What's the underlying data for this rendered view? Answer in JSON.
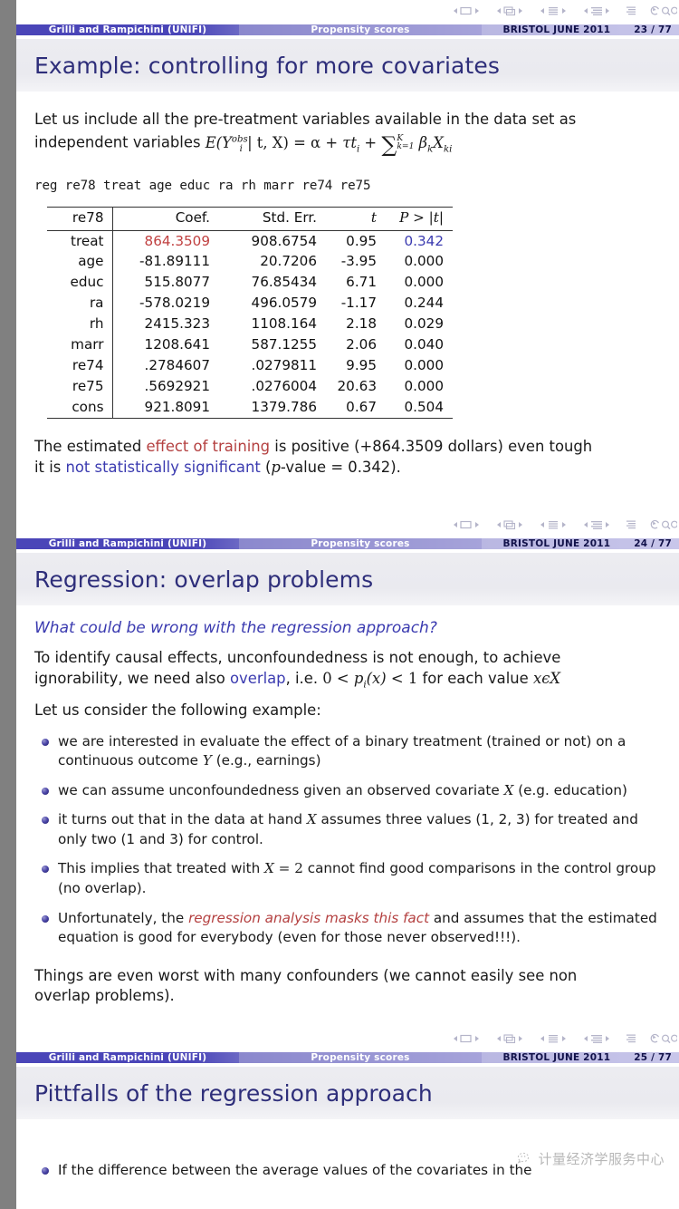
{
  "footer": {
    "author": "Grilli and Rampichini  (UNIFI)",
    "short_title": "Propensity scores",
    "venue": "BRISTOL JUNE 2011"
  },
  "slides": [
    {
      "page_number": "23 / 77",
      "title": "Example: controlling for more covariates",
      "intro_line1": "Let us include all the pre-treatment variables available in the data set as",
      "intro_line2_lead": "independent variables",
      "formula": {
        "lhs_E": "E",
        "lhs_Y": "Y",
        "lhs_Y_sup": "obs",
        "lhs_Y_sub": "i",
        "cond": "| t, X) =",
        "alpha": "α",
        "plus1": "+",
        "tau": "τ",
        "t_i": "t",
        "t_i_sub": "i",
        "plus2": "+",
        "sum": "∑",
        "sum_upper": "K",
        "sum_lower": "k=1",
        "beta": "β",
        "beta_sub": "k",
        "X": "X",
        "X_sub": "ki"
      },
      "command": "reg re78 treat age educ ra rh marr re74 re75",
      "table": {
        "columns": [
          "re78",
          "Coef.",
          "Std. Err.",
          "t",
          "P > |t|"
        ],
        "rows": [
          {
            "var": "treat",
            "coef": "864.3509",
            "se": "908.6754",
            "t": "0.95",
            "p": "0.342",
            "coef_hl": "red",
            "p_hl": "blue"
          },
          {
            "var": "age",
            "coef": "-81.89111",
            "se": "20.7206",
            "t": "-3.95",
            "p": "0.000"
          },
          {
            "var": "educ",
            "coef": "515.8077",
            "se": "76.85434",
            "t": "6.71",
            "p": "0.000"
          },
          {
            "var": "ra",
            "coef": "-578.0219",
            "se": "496.0579",
            "t": "-1.17",
            "p": "0.244"
          },
          {
            "var": "rh",
            "coef": "2415.323",
            "se": "1108.164",
            "t": "2.18",
            "p": "0.029"
          },
          {
            "var": "marr",
            "coef": "1208.641",
            "se": "587.1255",
            "t": "2.06",
            "p": "0.040"
          },
          {
            "var": "re74",
            "coef": ".2784607",
            "se": ".0279811",
            "t": "9.95",
            "p": "0.000"
          },
          {
            "var": "re75",
            "coef": ".5692921",
            "se": ".0276004",
            "t": "20.63",
            "p": "0.000"
          },
          {
            "var": "cons",
            "coef": "921.8091",
            "se": "1379.786",
            "t": "0.67",
            "p": "0.504"
          }
        ]
      },
      "concl_a": "The estimated ",
      "concl_alert": "effect of training",
      "concl_b": " is positive (+864.3509 dollars) even tough",
      "concl_c": "it is ",
      "concl_struct": "not statistically significant",
      "concl_d": " (",
      "concl_p": "p",
      "concl_e": "-value = 0.342)."
    },
    {
      "page_number": "24 / 77",
      "title": "Regression: overlap problems",
      "block_head": "What could be wrong with the regression approach?",
      "p1_line1": "To identify causal effects, unconfoundedness is not enough, to achieve",
      "p1_line2_a": "ignorability, we need also ",
      "p1_overlap": "overlap",
      "p1_line2_b": ", i.e. ",
      "p1_math_a": "0 <",
      "p1_math_p": "p",
      "p1_math_p_sub": "i",
      "p1_math_x": "(x)",
      "p1_math_b": "< 1",
      "p1_line2_c": " for each value ",
      "p1_math_xex": "xϵX",
      "p2": "Let us consider the following example:",
      "bullets": [
        {
          "parts": [
            {
              "t": "we are interested in evaluate the effect of a binary treatment (trained or not) on a continuous outcome "
            },
            {
              "t": "Y",
              "s": "mi"
            },
            {
              "t": " (e.g., earnings)"
            }
          ]
        },
        {
          "parts": [
            {
              "t": "we can assume unconfoundedness given an observed covariate "
            },
            {
              "t": "X",
              "s": "mi"
            },
            {
              "t": " (e.g. education)"
            }
          ]
        },
        {
          "parts": [
            {
              "t": "it turns out that in the data at hand "
            },
            {
              "t": "X",
              "s": "mi"
            },
            {
              "t": " assumes three values (1, 2, 3) for treated and only two (1 and 3) for control."
            }
          ]
        },
        {
          "parts": [
            {
              "t": "This implies that treated with "
            },
            {
              "t": "X",
              "s": "mi"
            },
            {
              "t": " = 2",
              "s": "mr"
            },
            {
              "t": " cannot find good comparisons in the control group (no overlap)."
            }
          ]
        },
        {
          "parts": [
            {
              "t": "Unfortunately, the "
            },
            {
              "t": "regression analysis masks this fact",
              "s": "alert-italic"
            },
            {
              "t": " and assumes that the estimated equation is good for everybody (even for those never observed!!!)."
            }
          ]
        }
      ],
      "tail_line1": "Things are even worst with many confounders (we cannot easily see non",
      "tail_line2": "overlap problems)."
    },
    {
      "page_number": "25 / 77",
      "title": "Pittfalls of the regression approach",
      "bullets": [
        {
          "parts": [
            {
              "t": "If the difference between the average values of the covariates in the"
            }
          ]
        }
      ]
    }
  ],
  "watermark": {
    "text": "计量经济学服务中心",
    "icon": "wechat-icon"
  },
  "nav_symbols": [
    "slide-prev-next-icon",
    "frame-prev-next-icon",
    "subsection-prev-next-icon",
    "section-prev-next-icon",
    "doc-icon",
    "back-find-icon"
  ],
  "colors": {
    "structure": "#3b3bb0",
    "alert": "#b44040",
    "title": "#2e2e7a",
    "footer_author_bg": "#4a45b8",
    "footer_title_bg": "#8b88cd",
    "footer_right_bg": "#b9b7e2",
    "page_bg": "#808080"
  }
}
